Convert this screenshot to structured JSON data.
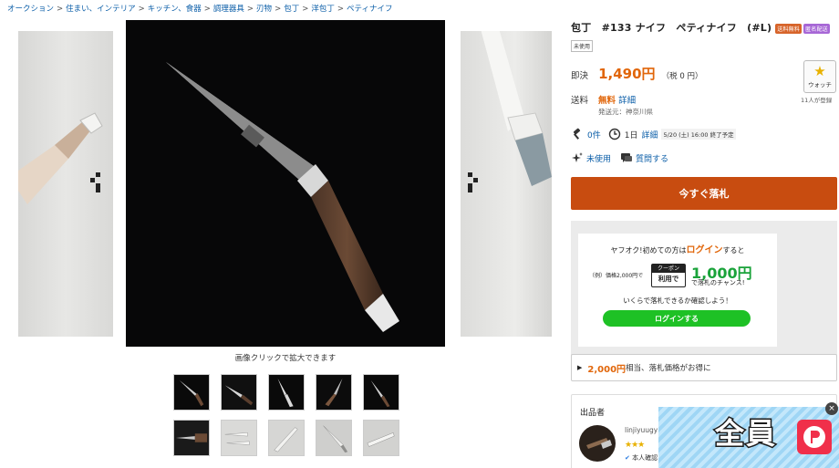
{
  "breadcrumb": [
    "オークション",
    "住まい、インテリア",
    "キッチン、食器",
    "調理器具",
    "刃物",
    "包丁",
    "洋包丁",
    "ペティナイフ"
  ],
  "breadcrumb_sep": ">",
  "gallery": {
    "caption": "画像クリックで拡大できます",
    "thumbnail_count": 10
  },
  "item": {
    "title": "包丁　#133 ナイフ　ペティナイフ　(#L)",
    "tag_free_shipping": "送料無料",
    "tag_anonymous": "匿名配送",
    "condition": "未使用"
  },
  "price": {
    "label": "即決",
    "amount": "1,490円",
    "tax": "（税 0 円）"
  },
  "watch": {
    "label": "ウォッチ",
    "count": "11人が登録"
  },
  "shipping": {
    "label": "送料",
    "value": "無料",
    "detail": "詳細",
    "origin": "発送元：神奈川県"
  },
  "stats": {
    "bids": "0件",
    "time_left": "1日",
    "detail": "詳細",
    "end_date": "5/20 (土) 16:00 終了予定"
  },
  "actions": {
    "unused": "未使用",
    "question": "質問する"
  },
  "buy_button": "今すぐ落札",
  "promo": {
    "line1_a": "ヤフオク!初めての方は",
    "line1_b": "ログイン",
    "line1_c": "すると",
    "before": "（例）価格2,000円で",
    "coupon_top": "クーポン",
    "coupon_bottom": "利用で",
    "amount": "1,000円",
    "chance": "で落札のチャンス!",
    "line3": "いくらで落札できるか確認しよう！",
    "login_button": "ログインする"
  },
  "bid_hint": {
    "amount": "2,000円",
    "text": "相当、落札価格がお得に"
  },
  "seller": {
    "heading": "出品者",
    "name": "linjiyuugy",
    "stars": "★★★",
    "verified": "本人確認"
  },
  "ad": {
    "text": "全員",
    "close": "×"
  }
}
